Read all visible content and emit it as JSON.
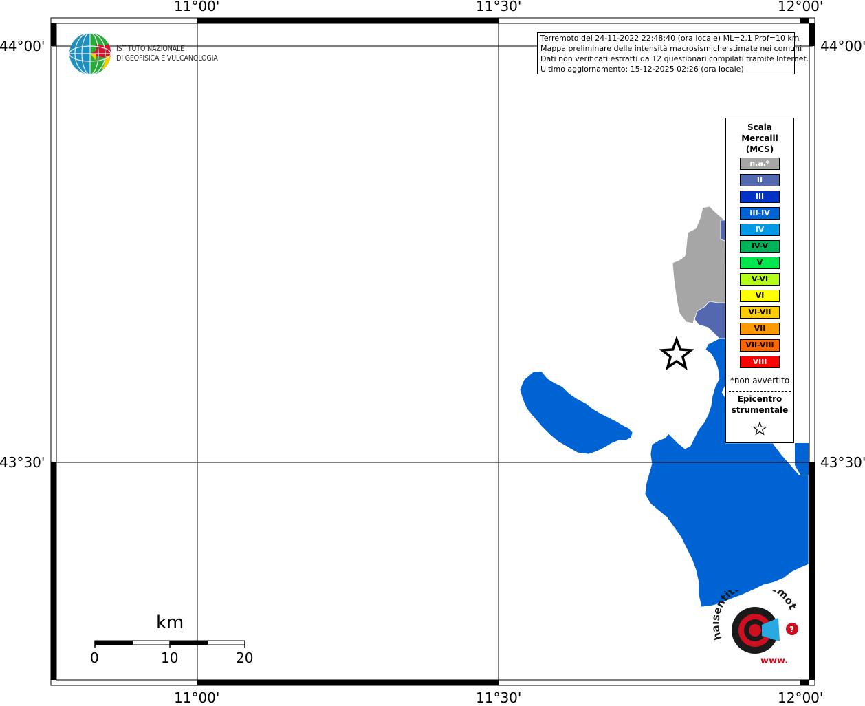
{
  "coordinates": {
    "lon_top": [
      "11°00'",
      "11°30'",
      "12°00'"
    ],
    "lon_bottom": [
      "11°00'",
      "11°30'",
      "12°00'"
    ],
    "lat_left": [
      "44°00'",
      "43°30'"
    ],
    "lat_right": [
      "44°00'",
      "43°30'"
    ]
  },
  "institute": {
    "line1": "ISTITUTO NAZIONALE",
    "line2": "DI GEOFISICA E VULCANOLOGIA"
  },
  "info": {
    "line1": "Terremoto del 24-11-2022 22:48:40 (ora locale) ML=2.1 Prof=10 km",
    "line2": "Mappa preliminare delle intensità macrosismiche stimate nei comuni",
    "line3": "Dati non verificati estratti da 12 questionari compilati tramite Internet.",
    "line4": "Ultimo aggiornamento: 15-12-2025 02:26 (ora locale)"
  },
  "legend": {
    "title_line1": "Scala",
    "title_line2": "Mercalli",
    "title_line3": "(MCS)",
    "items": [
      {
        "label": "n.a.*",
        "color": "#a6a6a6",
        "text_color": "#ffffff"
      },
      {
        "label": "II",
        "color": "#5468b0",
        "text_color": "#ffffff"
      },
      {
        "label": "III",
        "color": "#0033c4",
        "text_color": "#ffffff"
      },
      {
        "label": "III-IV",
        "color": "#0063d3",
        "text_color": "#ffffff"
      },
      {
        "label": "IV",
        "color": "#0099e6",
        "text_color": "#ffffff"
      },
      {
        "label": "IV-V",
        "color": "#00b359",
        "text_color": "#000000"
      },
      {
        "label": "V",
        "color": "#00e64d",
        "text_color": "#000000"
      },
      {
        "label": "V-VI",
        "color": "#b3ff1a",
        "text_color": "#000000"
      },
      {
        "label": "VI",
        "color": "#ffff00",
        "text_color": "#000000"
      },
      {
        "label": "VI-VII",
        "color": "#ffcc00",
        "text_color": "#000000"
      },
      {
        "label": "VII",
        "color": "#ff9900",
        "text_color": "#000000"
      },
      {
        "label": "VII-VIII",
        "color": "#ff6600",
        "text_color": "#000000"
      },
      {
        "label": "VIII",
        "color": "#ff0000",
        "text_color": "#ffffff"
      }
    ],
    "note": "*non avvertito",
    "epicenter_line1": "Epicentro",
    "epicenter_line2": "strumentale"
  },
  "scale_bar": {
    "unit": "km",
    "ticks": [
      "0",
      "10",
      "20"
    ]
  },
  "areas": [
    {
      "name": "comune-na",
      "intensity": "n.a.*",
      "color": "#a6a6a6"
    },
    {
      "name": "comune-ii",
      "intensity": "II",
      "color": "#5468b0"
    },
    {
      "name": "comune-iii-iv",
      "intensity": "III-IV",
      "color": "#0063d3"
    }
  ],
  "hsit_logo": {
    "text": "haisentitoilterremoto.it",
    "www": "www."
  }
}
